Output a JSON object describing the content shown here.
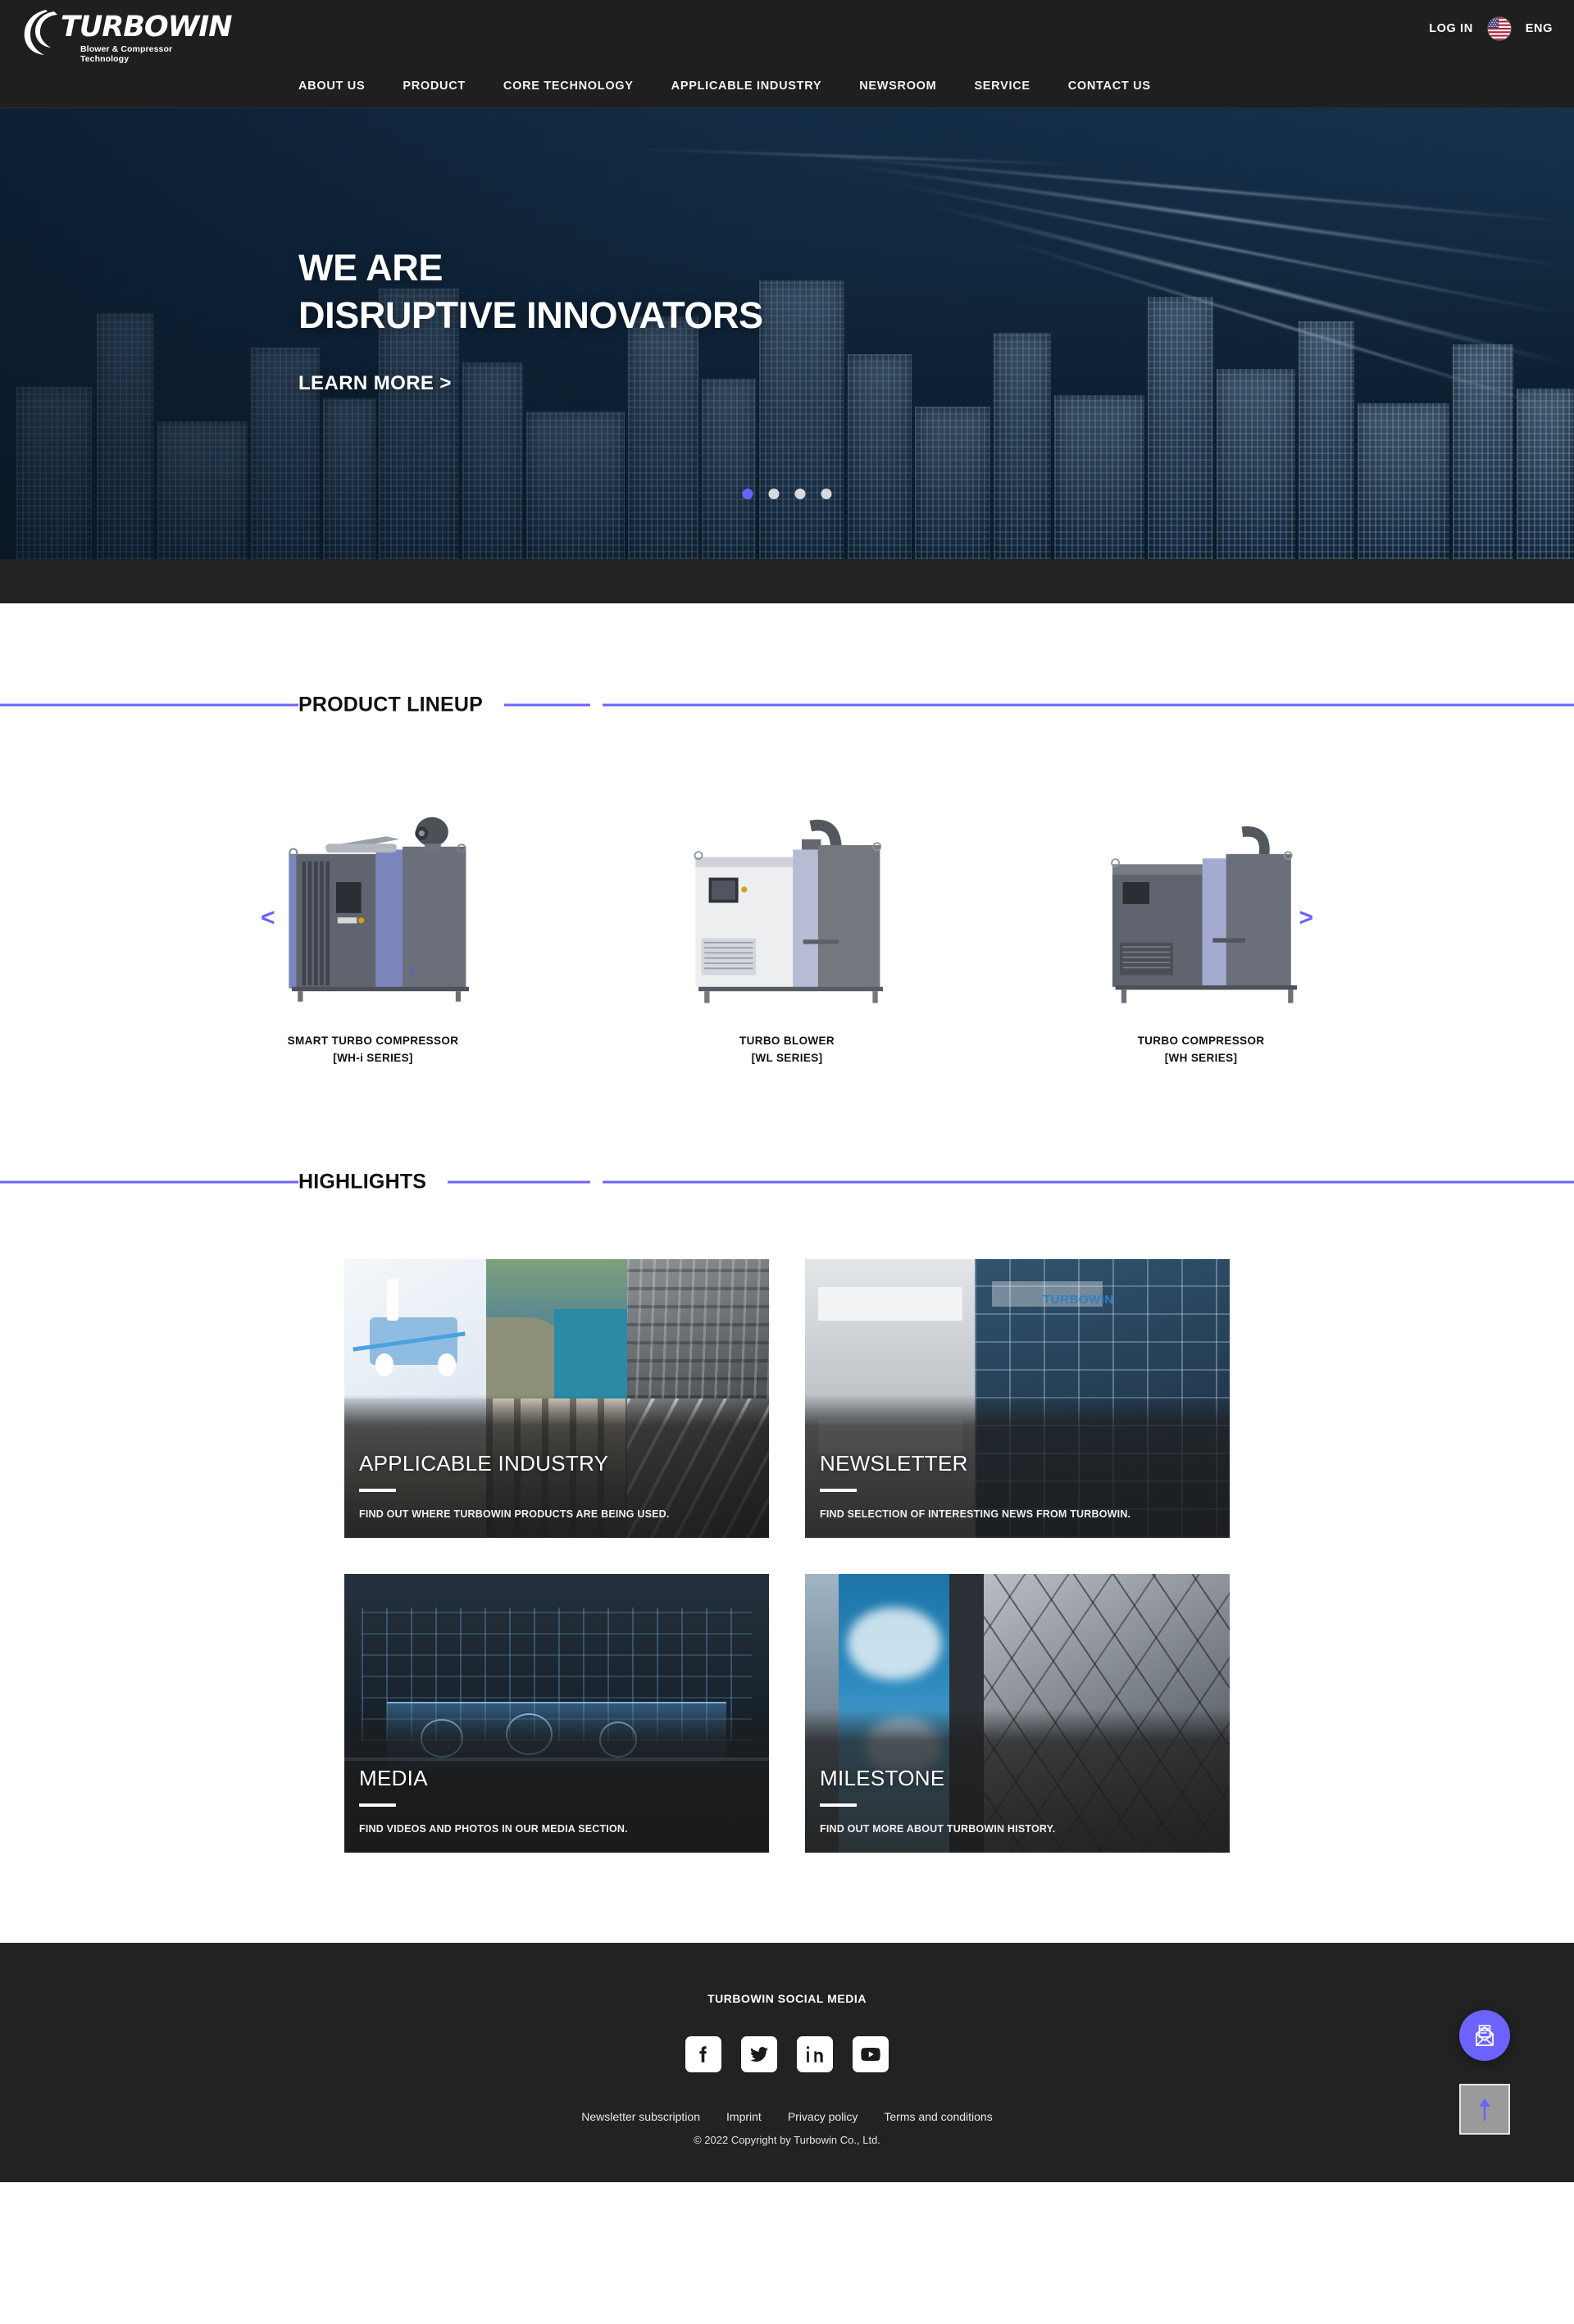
{
  "brand": {
    "name": "TURBOWIN",
    "tagline": "Blower & Compressor Technology",
    "logo_icon": "turbine-swoosh-icon"
  },
  "topbar": {
    "login_label": "LOG IN",
    "flag_icon": "us-flag-icon",
    "language": "ENG"
  },
  "nav": {
    "items": [
      {
        "label": "ABOUT US"
      },
      {
        "label": "PRODUCT"
      },
      {
        "label": "CORE TECHNOLOGY"
      },
      {
        "label": "APPLICABLE INDUSTRY"
      },
      {
        "label": "NEWSROOM"
      },
      {
        "label": "SERVICE"
      },
      {
        "label": "CONTACT US"
      }
    ]
  },
  "hero": {
    "line1": "WE ARE",
    "line2": "DISRUPTIVE INNOVATORS",
    "cta_label": "LEARN MORE >",
    "slide_count": 4,
    "active_slide": 1,
    "accent_color": "#6c63ff"
  },
  "product_lineup": {
    "heading": "PRODUCT LINEUP",
    "prev_label": "<",
    "next_label": ">",
    "items": [
      {
        "name": "SMART TURBO COMPRESSOR",
        "series": "[WH-i SERIES]",
        "image": "smart-turbo-compressor-photo"
      },
      {
        "name": "TURBO BLOWER",
        "series": "[WL SERIES]",
        "image": "turbo-blower-photo"
      },
      {
        "name": "TURBO COMPRESSOR",
        "series": "[WH SERIES]",
        "image": "turbo-compressor-photo"
      }
    ]
  },
  "highlights": {
    "heading": "HIGHLIGHTS",
    "cards": [
      {
        "title": "APPLICABLE INDUSTRY",
        "desc": "FIND OUT WHERE TURBOWIN PRODUCTS ARE BEING USED."
      },
      {
        "title": "NEWSLETTER",
        "desc": "FIND SELECTION OF INTERESTING NEWS FROM TURBOWIN."
      },
      {
        "title": "MEDIA",
        "desc": "FIND VIDEOS AND PHOTOS IN OUR MEDIA SECTION."
      },
      {
        "title": "MILESTONE",
        "desc": "FIND OUT MORE ABOUT TURBOWIN HISTORY."
      }
    ]
  },
  "footer": {
    "social_heading": "TURBOWIN SOCIAL MEDIA",
    "socials": [
      {
        "icon": "facebook-icon",
        "name": "Facebook"
      },
      {
        "icon": "twitter-icon",
        "name": "Twitter"
      },
      {
        "icon": "linkedin-icon",
        "name": "LinkedIn"
      },
      {
        "icon": "youtube-icon",
        "name": "YouTube"
      }
    ],
    "links": [
      {
        "label": "Newsletter subscription"
      },
      {
        "label": "Imprint"
      },
      {
        "label": "Privacy policy"
      },
      {
        "label": "Terms and conditions"
      }
    ],
    "copyright": "© 2022 Copyright by Turbowin Co., Ltd."
  },
  "floating": {
    "mail_icon": "open-envelope-icon",
    "scroll_top_icon": "arrow-up-icon"
  },
  "colors": {
    "accent": "#6c63ff",
    "dark": "#222222",
    "topbar": "#1f1f1f"
  }
}
